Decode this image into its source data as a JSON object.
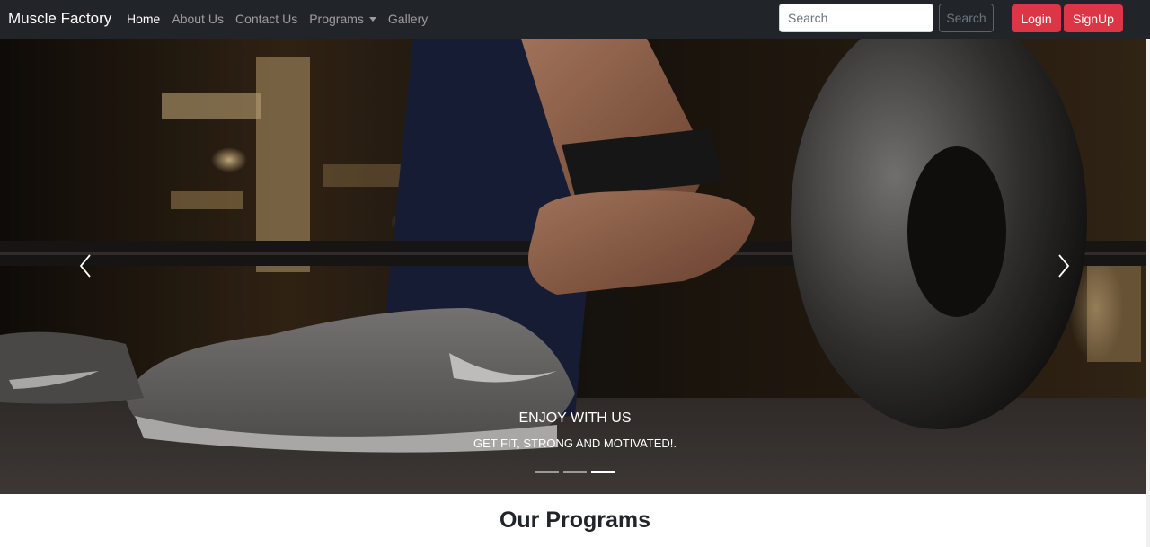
{
  "navbar": {
    "brand": "Muscle Factory",
    "links": [
      {
        "label": "Home",
        "active": true
      },
      {
        "label": "About Us",
        "active": false
      },
      {
        "label": "Contact Us",
        "active": false
      },
      {
        "label": "Programs",
        "active": false,
        "dropdown": true
      },
      {
        "label": "Gallery",
        "active": false
      }
    ],
    "search": {
      "placeholder": "Search",
      "value": "",
      "button_label": "Search"
    },
    "login_label": "Login",
    "signup_label": "SignUp"
  },
  "carousel": {
    "caption_title": "ENJOY WITH US",
    "caption_subtitle": "GET FIT, STRONG AND MOTIVATED!.",
    "slide_count": 3,
    "active_slide": 3,
    "prev_icon": "chevron-left-icon",
    "next_icon": "chevron-right-icon"
  },
  "programs": {
    "title": "Our Programs"
  },
  "colors": {
    "navbar_bg": "#212529",
    "accent": "#dc3545"
  }
}
